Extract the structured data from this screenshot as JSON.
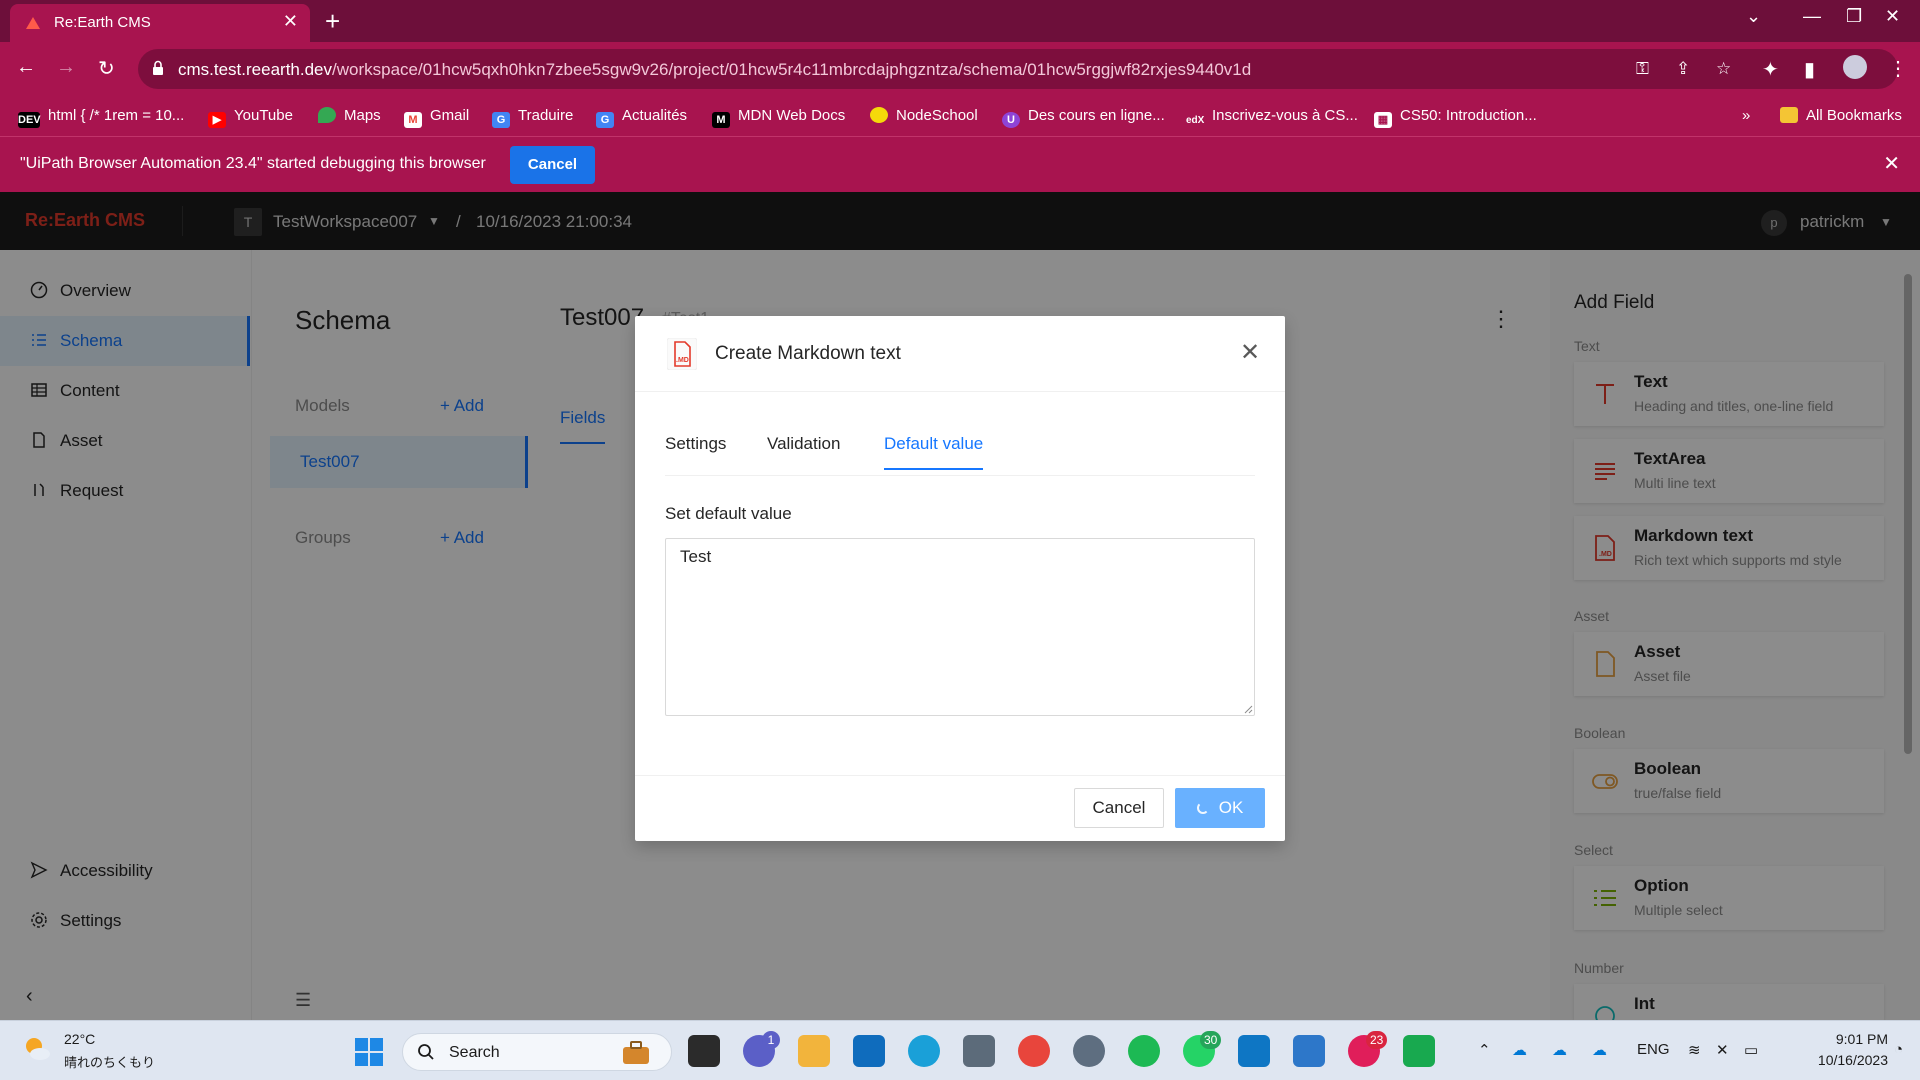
{
  "browser": {
    "tab_title": "Re:Earth CMS",
    "url_host": "cms.test.reearth.dev",
    "url_path": "/workspace/01hcw5qxh0hkn7zbee5sgw9v26/project/01hcw5r4c11mbrcdajphgzntza/schema/01hcw5rggjwf82rxjes9440v1d",
    "bookmarks": [
      {
        "label": "html { /* 1rem = 10...",
        "icon": "DEV"
      },
      {
        "label": "YouTube",
        "icon": "youtube-icon"
      },
      {
        "label": "Maps",
        "icon": "maps-icon"
      },
      {
        "label": "Gmail",
        "icon": "gmail-icon"
      },
      {
        "label": "Traduire",
        "icon": "translate-icon"
      },
      {
        "label": "Actualités",
        "icon": "news-icon"
      },
      {
        "label": "MDN Web Docs",
        "icon": "mdn-icon"
      },
      {
        "label": "NodeSchool",
        "icon": "nodeschool-icon"
      },
      {
        "label": "Des cours en ligne...",
        "icon": "udemy-icon"
      },
      {
        "label": "Inscrivez-vous à CS...",
        "icon": "edx-icon"
      },
      {
        "label": "CS50: Introduction...",
        "icon": "cs50-icon"
      }
    ],
    "more_bookmarks": "»",
    "all_bookmarks": "All Bookmarks",
    "infobar": {
      "message": "\"UiPath Browser Automation 23.4\" started debugging this browser",
      "cancel_label": "Cancel"
    }
  },
  "app": {
    "brand": "Re:Earth CMS",
    "workspace_initial": "T",
    "workspace": "TestWorkspace007",
    "breadcrumb_sep": "/",
    "project": "10/16/2023 21:00:34",
    "user_initial": "p",
    "user": "patrickm",
    "nav": [
      {
        "label": "Overview",
        "icon": "dashboard-icon"
      },
      {
        "label": "Schema",
        "icon": "list-icon",
        "active": true
      },
      {
        "label": "Content",
        "icon": "table-icon"
      },
      {
        "label": "Asset",
        "icon": "file-icon"
      },
      {
        "label": "Request",
        "icon": "pull-request-icon"
      }
    ],
    "nav_bottom": [
      {
        "label": "Accessibility",
        "icon": "send-icon"
      },
      {
        "label": "Settings",
        "icon": "gear-icon"
      }
    ],
    "schema": {
      "title": "Schema",
      "models_label": "Models",
      "add_label": "+ Add",
      "models": [
        "Test007"
      ],
      "groups_label": "Groups"
    },
    "model": {
      "title": "Test007",
      "key": "#Test1",
      "tab": "Fields"
    },
    "add_field": {
      "title": "Add Field",
      "groups": [
        {
          "label": "Text",
          "items": [
            {
              "name": "Text",
              "desc": "Heading and titles, one-line field",
              "icon": "text-field-icon"
            },
            {
              "name": "TextArea",
              "desc": "Multi line text",
              "icon": "textarea-icon"
            },
            {
              "name": "Markdown text",
              "desc": "Rich text which supports md style",
              "icon": "markdown-icon"
            }
          ]
        },
        {
          "label": "Asset",
          "items": [
            {
              "name": "Asset",
              "desc": "Asset file",
              "icon": "asset-file-icon"
            }
          ]
        },
        {
          "label": "Boolean",
          "items": [
            {
              "name": "Boolean",
              "desc": "true/false field",
              "icon": "toggle-icon"
            }
          ]
        },
        {
          "label": "Select",
          "items": [
            {
              "name": "Option",
              "desc": "Multiple select",
              "icon": "option-list-icon"
            }
          ]
        },
        {
          "label": "Number",
          "items": [
            {
              "name": "Int",
              "desc": "",
              "icon": "int-icon"
            }
          ]
        }
      ]
    }
  },
  "modal": {
    "title": "Create Markdown text",
    "tabs": [
      "Settings",
      "Validation",
      "Default value"
    ],
    "active_tab": "Default value",
    "field_label": "Set default value",
    "value": "Test",
    "cancel_label": "Cancel",
    "ok_label": "OK"
  },
  "taskbar": {
    "weather_temp": "22°C",
    "weather_desc": "晴れのちくもり",
    "search_label": "Search",
    "badges": {
      "teams": "1",
      "whatsapp": "30",
      "slack": "23"
    },
    "language": "ENG",
    "time": "9:01 PM",
    "date": "10/16/2023"
  },
  "colors": {
    "browser_frame": "#a8144f",
    "app_header": "#1d1d1d",
    "brand_red": "#e33a2b",
    "primary_blue": "#1677ff"
  }
}
